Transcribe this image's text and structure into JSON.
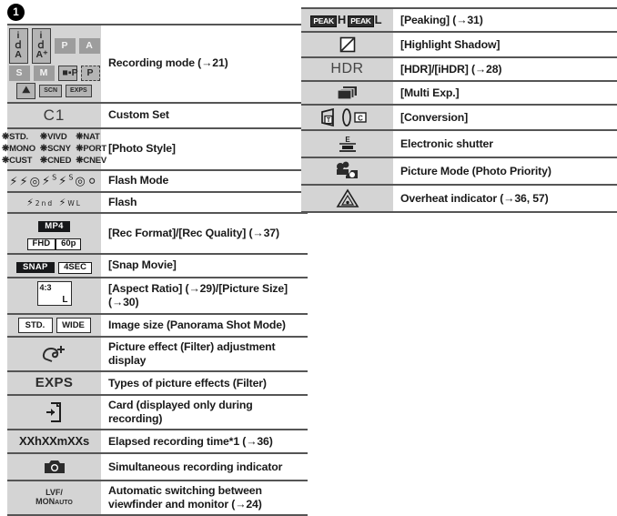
{
  "section": {
    "number": "1"
  },
  "left_table": {
    "rows": [
      {
        "icon_name": "recording-mode-icons",
        "icon_text": "iA iA+ P A S M MP P SCN EXPS",
        "desc": "Recording mode (→21)"
      },
      {
        "icon_name": "custom-set-icon",
        "icon_text": "C1",
        "desc": "Custom Set"
      },
      {
        "icon_name": "photo-style-icons",
        "icon_text": "STD. VIVD NAT MONO SCNY PORT CUST CNED CNEV",
        "desc": "[Photo Style]"
      },
      {
        "icon_name": "flash-mode-icons",
        "icon_text": "flash glyphs",
        "desc": "Flash Mode"
      },
      {
        "icon_name": "flash-icons",
        "icon_text": "2nd WL",
        "desc": "Flash"
      },
      {
        "icon_name": "rec-format-icon",
        "icon_text": "MP4 FHD 60p",
        "desc": "[Rec Format]/[Rec Quality] (→37)"
      },
      {
        "icon_name": "snap-movie-icon",
        "icon_text": "SNAP 4SEC",
        "desc": "[Snap Movie]"
      },
      {
        "icon_name": "aspect-ratio-icon",
        "icon_text": "4:3 L",
        "desc": "[Aspect Ratio] (→29)/[Picture Size] (→30)"
      },
      {
        "icon_name": "panorama-size-icons",
        "icon_text": "STD. WIDE",
        "desc": "Image size (Panorama Shot Mode)"
      },
      {
        "icon_name": "picture-effect-adjust-icon",
        "icon_text": "filter+",
        "desc": "Picture effect (Filter) adjustment display"
      },
      {
        "icon_name": "picture-effect-type-icon",
        "icon_text": "EXPS",
        "desc": "Types of picture effects (Filter)"
      },
      {
        "icon_name": "card-icon",
        "icon_text": "card",
        "desc": "Card (displayed only during recording)"
      },
      {
        "icon_name": "elapsed-time-icon",
        "icon_text": "XXhXXmXXs",
        "desc": "Elapsed recording time*1 (→36)"
      },
      {
        "icon_name": "simultaneous-recording-icon",
        "icon_text": "camera",
        "desc": "Simultaneous recording indicator"
      },
      {
        "icon_name": "lvf-mon-auto-icon",
        "icon_text": "LVF/MONAUTO",
        "desc": "Automatic switching between viewfinder and monitor (→24)"
      }
    ],
    "mode_keys": [
      {
        "label": "iA",
        "style": "boxed"
      },
      {
        "label": "iA+",
        "style": "boxed"
      },
      {
        "label": "P",
        "style": "flat"
      },
      {
        "label": "A",
        "style": "flat"
      },
      {
        "label": "S",
        "style": "flat"
      },
      {
        "label": "M",
        "style": "flat"
      },
      {
        "label": "MP",
        "style": "boxed"
      },
      {
        "label": "P",
        "style": "dash"
      },
      {
        "label": "SCN-img",
        "style": "boxed"
      },
      {
        "label": "SCN",
        "style": "boxed"
      },
      {
        "label": "EXPS",
        "style": "boxed"
      }
    ],
    "custom_set_label": "C1",
    "photo_styles": [
      "STD.",
      "VIVD",
      "NAT",
      "MONO",
      "SCNY",
      "PORT",
      "CUST",
      "CNED",
      "CNEV"
    ],
    "flash_sub_labels": [
      "2nd",
      "WL"
    ],
    "rec_format": {
      "line1": "MP4",
      "line2a": "FHD",
      "line2b": "60p"
    },
    "snap_movie": {
      "line1": "SNAP",
      "line2": "4SEC"
    },
    "aspect": {
      "ratio": "4:3",
      "size": "L"
    },
    "panorama": [
      "STD.",
      "WIDE"
    ],
    "effect_type_label": "EXPS",
    "elapsed_label": "XXhXXmXXs",
    "lvf": {
      "line1": "LVF/",
      "line2": "MON",
      "sub": "AUTO"
    }
  },
  "right_table": {
    "rows": [
      {
        "icon_name": "peaking-icons",
        "icon_text": "PEAK H PEAK L",
        "desc": "[Peaking] (→31)"
      },
      {
        "icon_name": "highlight-shadow-icon",
        "icon_text": "diagonal box",
        "desc": "[Highlight Shadow]"
      },
      {
        "icon_name": "hdr-icon",
        "icon_text": "HDR",
        "desc": "[HDR]/[iHDR] (→28)"
      },
      {
        "icon_name": "multi-exposure-icon",
        "icon_text": "stacked frames",
        "desc": "[Multi Exp.]"
      },
      {
        "icon_name": "conversion-icon",
        "icon_text": "T lens C",
        "desc": "[Conversion]"
      },
      {
        "icon_name": "electronic-shutter-icon",
        "icon_text": "E shutter",
        "desc": "Electronic shutter"
      },
      {
        "icon_name": "picture-mode-photo-priority-icon",
        "icon_text": "movie camera",
        "desc": "Picture Mode (Photo Priority)"
      },
      {
        "icon_name": "overheat-indicator-icon",
        "icon_text": "warning triangle",
        "desc": "Overheat indicator (→36, 57)"
      }
    ],
    "peaking": {
      "chip": "PEAK",
      "high": "H",
      "low": "L"
    },
    "hdr_label": "HDR",
    "conversion": {
      "tele": "T",
      "close": "C"
    },
    "electronic_shutter_label": "E"
  }
}
